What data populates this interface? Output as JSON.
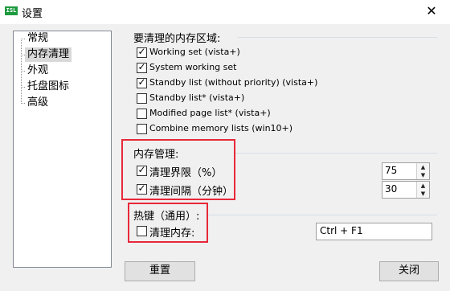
{
  "window": {
    "app_icon_text": "ISL",
    "title": "设置",
    "close_glyph": "✕"
  },
  "sidebar": {
    "items": [
      {
        "label": "常规"
      },
      {
        "label": "内存清理",
        "selected": true
      },
      {
        "label": "外观"
      },
      {
        "label": "托盘图标"
      },
      {
        "label": "高级"
      }
    ]
  },
  "clean_areas": {
    "heading": "要清理的内存区域:",
    "options": [
      {
        "label": "Working set (vista+)",
        "checked": true
      },
      {
        "label": "System working set",
        "checked": true
      },
      {
        "label": "Standby list (without priority) (vista+)",
        "checked": true
      },
      {
        "label": "Standby list* (vista+)",
        "checked": false
      },
      {
        "label": "Modified page list* (vista+)",
        "checked": false
      },
      {
        "label": "Combine memory lists (win10+)",
        "checked": false
      }
    ]
  },
  "memory_management": {
    "heading": "内存管理:",
    "threshold": {
      "label": "清理界限（%）",
      "checked": true,
      "value": "75"
    },
    "interval": {
      "label": "清理间隔（分钟）",
      "checked": true,
      "value": "30"
    }
  },
  "hotkey": {
    "heading": "热键（通用）:",
    "clean_memory": {
      "label": "清理内存:",
      "checked": false,
      "value": "Ctrl + F1"
    }
  },
  "buttons": {
    "reset": "重置",
    "close": "关闭"
  },
  "colors": {
    "highlight_box": "#e8283a",
    "app_icon": "#1d9b3f"
  }
}
